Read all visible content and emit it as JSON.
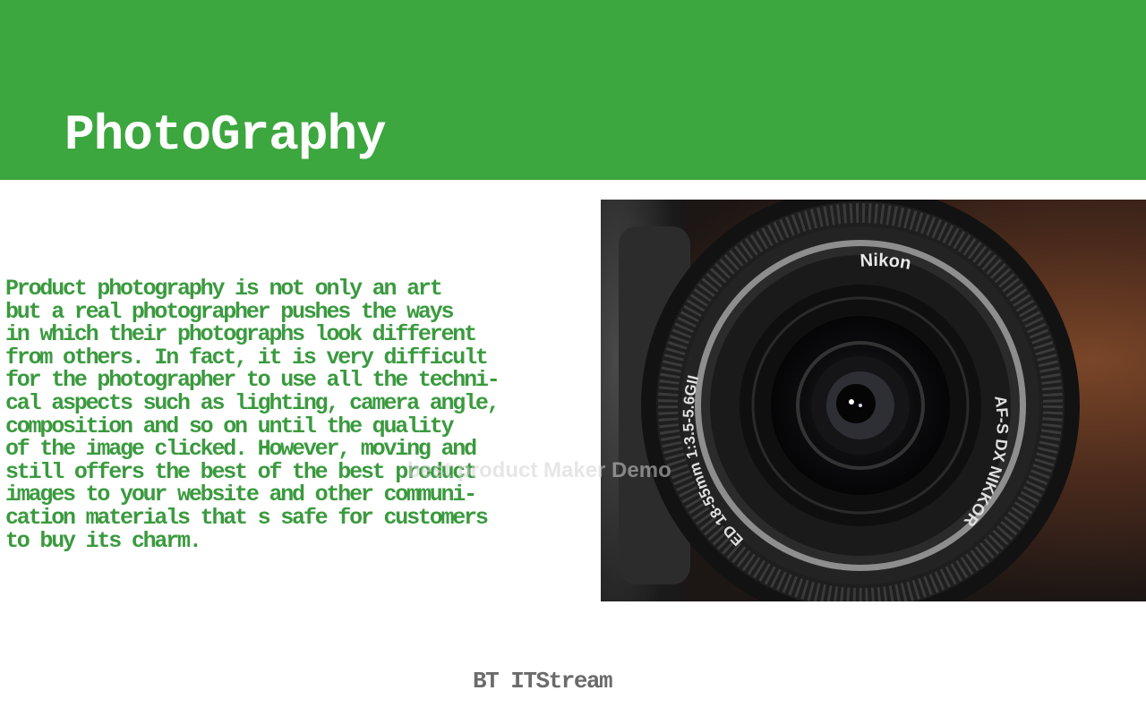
{
  "header": {
    "title": "PhotoGraphy",
    "background_color": "#3ca63f"
  },
  "content": {
    "paragraph": "Product photography is not only an art\nbut a real photographer pushes the ways\nin which their photographs look different\nfrom others. In fact, it is very difficult\nfor the photographer to use all the techni-\ncal aspects such as lighting, camera angle,\ncomposition and so on until the quality\nof the image clicked. However, moving and\nstill offers the best of the best product\nimages to your website and other communi-\ncation materials that s safe for customers\nto buy its charm.",
    "text_color": "#3a9a3e"
  },
  "photo": {
    "icon": "camera-lens-photo",
    "brand_text": "Nikon",
    "lens_text_left": "ED 18-55mm 1:3.5-5.6GII",
    "lens_text_right": "AF-S DX NIKKOR"
  },
  "watermark": {
    "text": "best product Maker Demo"
  },
  "footer": {
    "credit": "BT ITStream",
    "text_color": "#6b6b6b"
  }
}
